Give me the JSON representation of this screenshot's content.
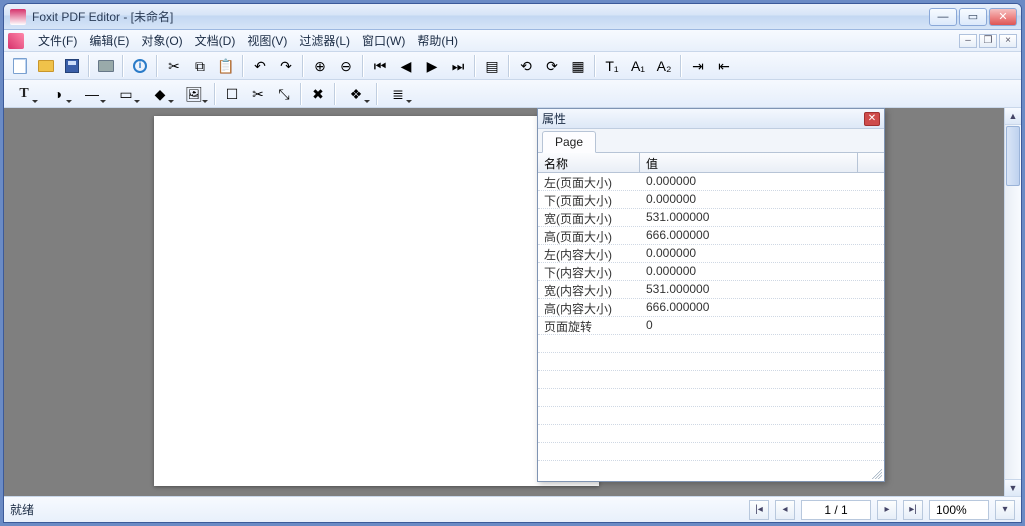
{
  "window": {
    "title": "Foxit PDF Editor - [未命名]"
  },
  "menu": {
    "items": [
      "文件(F)",
      "编辑(E)",
      "对象(O)",
      "文档(D)",
      "视图(V)",
      "过滤器(L)",
      "窗口(W)",
      "帮助(H)"
    ]
  },
  "toolbar1_icons": [
    "new-page-icon",
    "open-icon",
    "save-icon",
    "sep",
    "print-icon",
    "sep",
    "info-icon",
    "sep",
    "cut-icon",
    "copy-icon",
    "paste-icon",
    "sep",
    "undo-icon",
    "redo-icon",
    "sep",
    "zoom-in-icon",
    "zoom-out-icon",
    "sep",
    "first-page-icon",
    "prev-page-icon",
    "next-page-icon",
    "last-page-icon",
    "sep",
    "fit-page-icon",
    "sep",
    "rotate-left-icon",
    "rotate-right-icon",
    "grid-icon",
    "sep",
    "tool-a-icon",
    "tool-b-icon",
    "tool-c-icon",
    "sep",
    "import-icon",
    "export-icon"
  ],
  "toolbar2_icons": [
    "text-tool-icon",
    "color-tool-icon",
    "line-tool-icon",
    "rect-tool-icon",
    "shape-tool-icon",
    "image-tool-icon",
    "sep",
    "select-tool-icon",
    "crop-tool-icon",
    "transform-tool-icon",
    "sep",
    "settings-icon",
    "sep",
    "layers-icon",
    "sep",
    "align-icon"
  ],
  "properties": {
    "title": "属性",
    "tab": "Page",
    "col_name": "名称",
    "col_value": "值",
    "rows": [
      {
        "n": "左(页面大小)",
        "v": "0.000000"
      },
      {
        "n": "下(页面大小)",
        "v": "0.000000"
      },
      {
        "n": "宽(页面大小)",
        "v": "531.000000"
      },
      {
        "n": "高(页面大小)",
        "v": "666.000000"
      },
      {
        "n": "左(内容大小)",
        "v": "0.000000"
      },
      {
        "n": "下(内容大小)",
        "v": "0.000000"
      },
      {
        "n": "宽(内容大小)",
        "v": "531.000000"
      },
      {
        "n": "高(内容大小)",
        "v": "666.000000"
      },
      {
        "n": "页面旋转",
        "v": "0"
      }
    ]
  },
  "status": {
    "text": "就绪",
    "page": "1 / 1",
    "zoom": "100%"
  }
}
